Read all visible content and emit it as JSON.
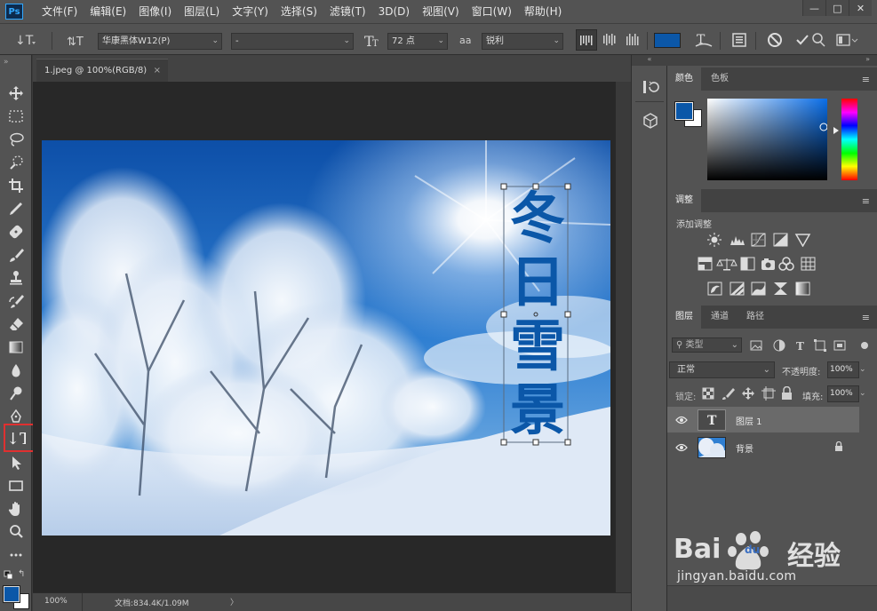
{
  "app": {
    "logo": "Ps"
  },
  "menu": [
    "文件(F)",
    "编辑(E)",
    "图像(I)",
    "图层(L)",
    "文字(Y)",
    "选择(S)",
    "滤镜(T)",
    "3D(D)",
    "视图(V)",
    "窗口(W)",
    "帮助(H)"
  ],
  "window_controls": {
    "minimize": "—",
    "maximize": "□",
    "close": "✕"
  },
  "options": {
    "font_family": "华康黑体W12(P)",
    "font_style": "-",
    "font_size": "72 点",
    "antialias_label": "aa",
    "antialias": "锐利",
    "text_color": "#0b57a8"
  },
  "document": {
    "tab_title": "1.jpeg @ 100%(RGB/8)",
    "tab_close": "×",
    "text_chars": [
      "冬",
      "日",
      "雪",
      "景"
    ],
    "zoom": "100%",
    "doc_size": "文档:834.4K/1.09M",
    "status_arrow": "〉"
  },
  "colors": {
    "foreground": "#0b57a8",
    "background": "#ffffff"
  },
  "color_panel": {
    "tabs": [
      "颜色",
      "色板"
    ]
  },
  "adjust_panel": {
    "tab": "调整",
    "add_label": "添加调整",
    "icons_row1": [
      "brightness-icon",
      "levels-icon",
      "curves-icon",
      "exposure-icon",
      "vibrance-icon"
    ],
    "icons_row2": [
      "hue-saturation-icon",
      "color-balance-icon",
      "black-white-icon",
      "photo-filter-icon",
      "channel-mixer-icon",
      "color-lookup-icon"
    ],
    "icons_row3": [
      "invert-icon",
      "posterize-icon",
      "threshold-icon",
      "selective-color-icon",
      "gradient-map-icon"
    ]
  },
  "layers_panel": {
    "tabs": [
      "图层",
      "通道",
      "路径"
    ],
    "filter_label": "类型",
    "blend_mode": "正常",
    "opacity_label": "不透明度:",
    "opacity": "100%",
    "lock_label": "锁定:",
    "fill_label": "填充:",
    "fill": "100%",
    "layers": [
      {
        "name": "图层 1",
        "type": "text",
        "selected": true
      },
      {
        "name": "背景",
        "type": "image",
        "selected": false,
        "locked": true
      }
    ]
  },
  "watermark": {
    "brand": "Bai",
    "brand2": "du",
    "cn": "经验",
    "url": "jingyan.baidu.com"
  }
}
